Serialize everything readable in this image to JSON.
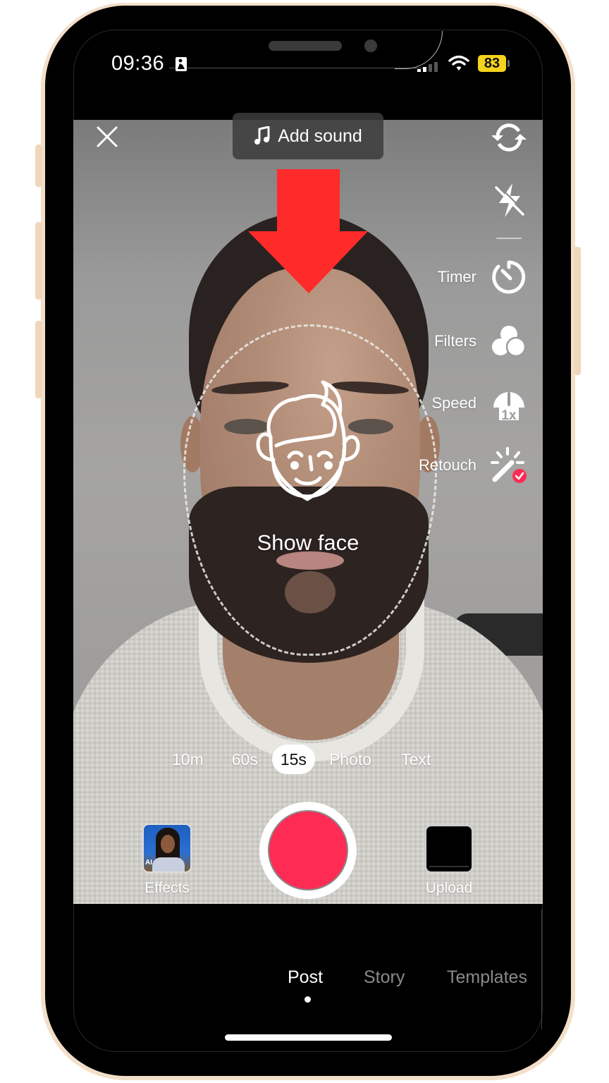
{
  "status_bar": {
    "time": "09:36",
    "battery_level": "83",
    "icons": [
      "person-activity-icon",
      "cellular-signal-icon",
      "wifi-icon",
      "battery-icon"
    ]
  },
  "camera_top": {
    "close_icon": "close-icon",
    "add_sound_label": "Add sound",
    "music_icon": "music-note-icon",
    "flip_icon": "flip-camera-icon",
    "flash_icon": "flash-off-icon"
  },
  "tools": [
    {
      "label": "Timer",
      "icon": "timer-icon"
    },
    {
      "label": "Filters",
      "icon": "filters-icon"
    },
    {
      "label": "Speed",
      "icon": "speed-icon",
      "badge": "1x"
    },
    {
      "label": "Retouch",
      "icon": "retouch-wand-icon",
      "enabled": true
    }
  ],
  "overlay": {
    "prompt": "Show face",
    "annotation_arrow_color": "#ff2a2a"
  },
  "durations": {
    "options": [
      "10m",
      "60s",
      "15s",
      "Photo",
      "Text"
    ],
    "selected": "15s"
  },
  "capture": {
    "effects_label": "Effects",
    "effects_badge": "AI",
    "upload_label": "Upload",
    "record_color": "#fe2c55"
  },
  "mode_tabs": {
    "items": [
      "Post",
      "Story",
      "Templates"
    ],
    "selected": "Post"
  }
}
